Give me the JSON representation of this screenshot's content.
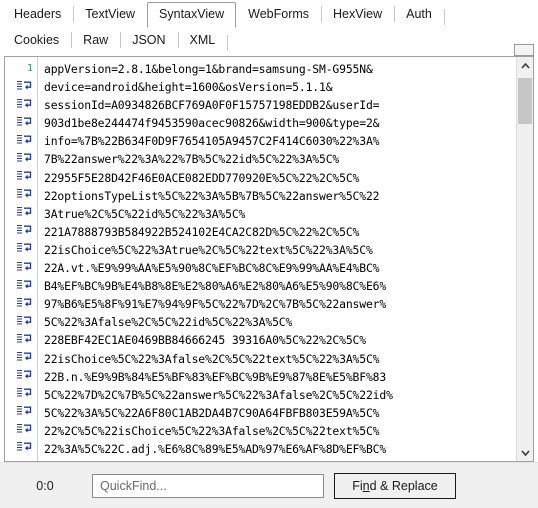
{
  "tabs_row1": [
    {
      "label": "Headers",
      "selected": false
    },
    {
      "label": "TextView",
      "selected": false
    },
    {
      "label": "SyntaxView",
      "selected": true
    },
    {
      "label": "WebForms",
      "selected": false
    },
    {
      "label": "HexView",
      "selected": false
    },
    {
      "label": "Auth",
      "selected": false
    }
  ],
  "tabs_row2": [
    {
      "label": "Cookies",
      "selected": false
    },
    {
      "label": "Raw",
      "selected": false
    },
    {
      "label": "JSON",
      "selected": false
    },
    {
      "label": "XML",
      "selected": false
    }
  ],
  "editor": {
    "first_line_number": "1",
    "wrap_marker_icon": "wrap-arrow-icon",
    "lines": [
      "appVersion=2.8.1&belong=1&brand=samsung-SM-G955N&",
      "device=android&height=1600&osVersion=5.1.1&",
      "sessionId=A0934826BCF769A0F0F15757198EDDB2&userId=",
      "903d1be8e244474f9453590acec90826&width=900&type=2&",
      "info=%7B%22B634F0D9F7654105A9457C2F414C6030%22%3A%",
      "7B%22answer%22%3A%22%7B%5C%22id%5C%22%3A%5C%",
      "22955F5E28D42F46E0ACE082EDD770920E%5C%22%2C%5C%",
      "22optionsTypeList%5C%22%3A%5B%7B%5C%22answer%5C%22",
      "3Atrue%2C%5C%22id%5C%22%3A%5C%",
      "221A7888793B584922B524102E4CA2C82D%5C%22%2C%5C%",
      "22isChoice%5C%22%3Atrue%2C%5C%22text%5C%22%3A%5C%",
      "22A.vt.%E9%99%AA%E5%90%8C%EF%BC%8C%E9%99%AA%E4%BC%",
      "B4%EF%BC%9B%E4%B8%8E%E2%80%A6%E2%80%A6%E5%90%8C%E6%",
      "97%B6%E5%8F%91%E7%94%9F%5C%22%7D%2C%7B%5C%22answer%",
      "5C%22%3Afalse%2C%5C%22id%5C%22%3A%5C%",
      "228EBF42EC1AE0469BB84666245 39316A0%5C%22%2C%5C%",
      "22isChoice%5C%22%3Afalse%2C%5C%22text%5C%22%3A%5C%",
      "22B.n.%E9%9B%84%E5%BF%83%EF%BC%9B%E9%87%8E%E5%BF%83",
      "5C%22%7D%2C%7B%5C%22answer%5C%22%3Afalse%2C%5C%22id%",
      "5C%22%3A%5C%22A6F80C1AB2DA4B7C90A64FBFB803E59A%5C%",
      "22%2C%5C%22isChoice%5C%22%3Afalse%2C%5C%22text%5C%",
      "22%3A%5C%22C.adj.%E6%8C%89%E5%AD%97%E6%AF%8D%EF%BC%"
    ]
  },
  "scrollbar": {
    "up_arrow_icon": "chevron-up-icon",
    "down_arrow_icon": "chevron-down-icon"
  },
  "statusbar": {
    "position": "0:0",
    "quickfind_placeholder": "QuickFind...",
    "quickfind_value": "",
    "find_replace_label_pre": "Fi",
    "find_replace_label_accel": "n",
    "find_replace_label_post": "d & Replace"
  },
  "colors": {
    "line_number": "#2e8b8b",
    "wrap_marker": "#1f3f8f",
    "editor_bg": "#ffffff",
    "chrome_bg": "#f0f0f0",
    "text": "#000000"
  }
}
